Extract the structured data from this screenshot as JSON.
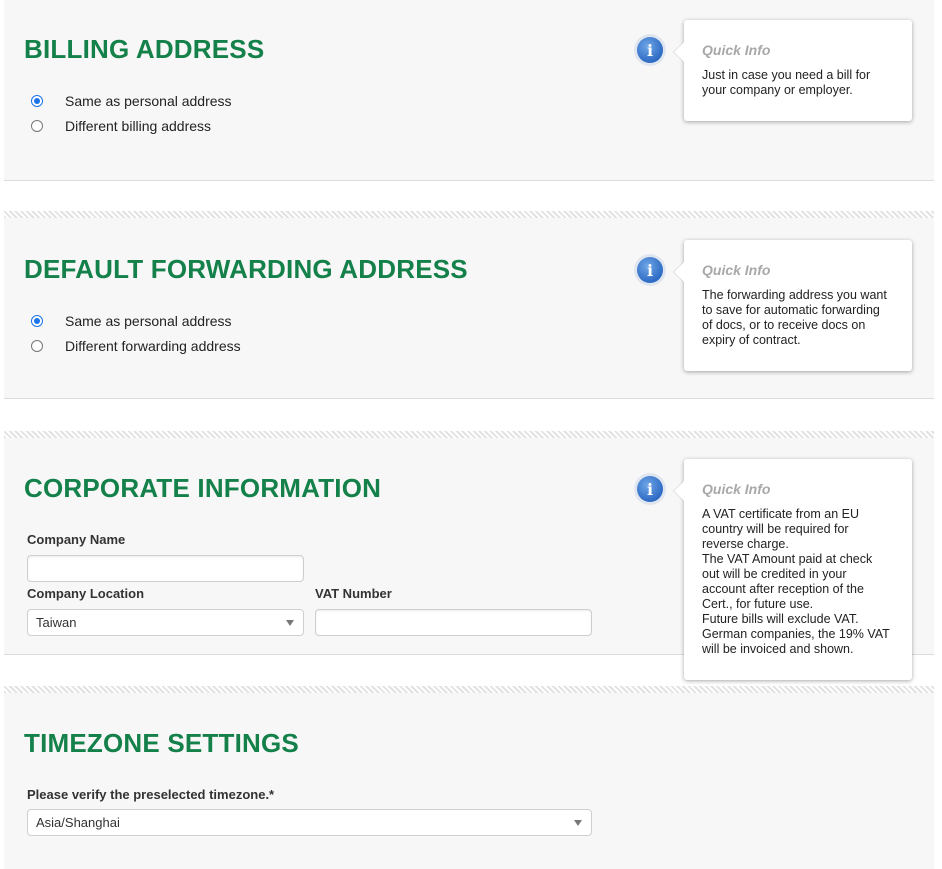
{
  "billing": {
    "title": "BILLING ADDRESS",
    "options": [
      "Same as personal address",
      "Different billing address"
    ],
    "selected": 0,
    "quick_info": {
      "title": "Quick Info",
      "text": "Just in case you need a bill for\nyour company or employer."
    }
  },
  "forwarding": {
    "title": "DEFAULT FORWARDING ADDRESS",
    "options": [
      "Same as personal address",
      "Different forwarding address"
    ],
    "selected": 0,
    "quick_info": {
      "title": "Quick Info",
      "text": "The forwarding address you want\nto save for automatic forwarding\nof docs, or to receive docs on\nexpiry of contract."
    }
  },
  "corporate": {
    "title": "CORPORATE INFORMATION",
    "company_name_label": "Company Name",
    "company_name_value": "",
    "company_location_label": "Company Location",
    "company_location_value": "Taiwan",
    "vat_number_label": "VAT Number",
    "vat_number_value": "",
    "quick_info": {
      "title": "Quick Info",
      "text": "A VAT certificate from an EU\ncountry will be required for\nreverse charge.\nThe VAT Amount paid at check\nout will be credited in your\naccount after reception of the\nCert., for future use.\nFuture bills will exclude VAT.\nGerman companies, the 19% VAT\nwill be invoiced and shown."
    }
  },
  "timezone": {
    "title": "TIMEZONE SETTINGS",
    "label": "Please verify the preselected timezone.*",
    "value": "Asia/Shanghai"
  },
  "colors": {
    "heading": "#14804a",
    "radio_checked": "#1a73e8",
    "info_icon": "#2e6bc4"
  }
}
